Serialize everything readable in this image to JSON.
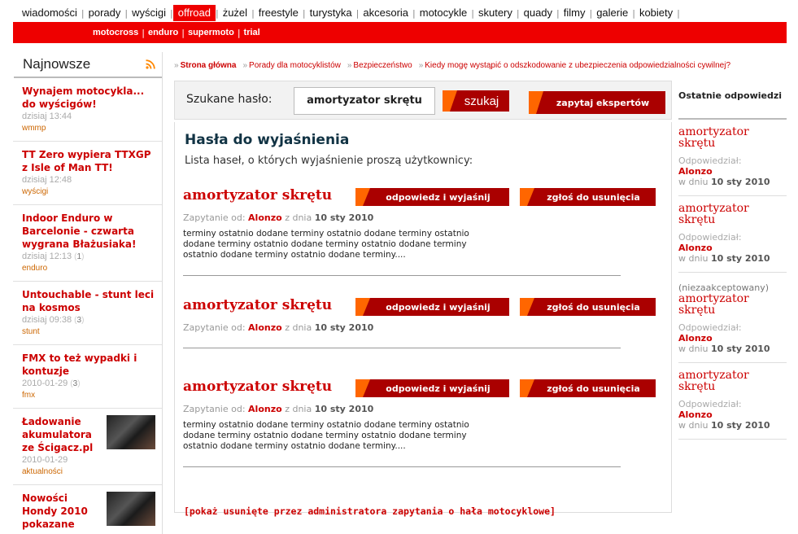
{
  "topnav": {
    "items": [
      "wiadomości",
      "porady",
      "wyścigi",
      "offroad",
      "żużel",
      "freestyle",
      "turystyka",
      "akcesoria",
      "motocykle",
      "skutery",
      "quady",
      "filmy",
      "galerie",
      "kobiety"
    ],
    "separator": "|",
    "active_index": 3
  },
  "subnav": {
    "items": [
      "motocross",
      "enduro",
      "supermoto",
      "trial"
    ],
    "separator": "|"
  },
  "left": {
    "title": "Najnowsze",
    "rss_icon": "rss-icon",
    "news": [
      {
        "title": "Wynajem motocykla... do wyścigów!",
        "time": "dzisiaj 13:44",
        "comments": "",
        "category": "wmmp",
        "thumb": false
      },
      {
        "title": "TT Zero wypiera TTXGP z Isle of Man TT!",
        "time": "dzisiaj 12:48",
        "comments": "",
        "category": "wyścigi",
        "thumb": false
      },
      {
        "title": "Indoor Enduro w Barcelonie - czwarta wygrana Błażusiaka!",
        "time": "dzisiaj 12:13",
        "comments": "1",
        "category": "enduro",
        "thumb": false
      },
      {
        "title": "Untouchable - stunt leci na kosmos",
        "time": "dzisiaj 09:38",
        "comments": "3",
        "category": "stunt",
        "thumb": false
      },
      {
        "title": "FMX to też wypadki i kontuzje",
        "time": "2010-01-29",
        "comments": "3",
        "category": "fmx",
        "thumb": false
      },
      {
        "title": "Ładowanie akumulatora ze Ścigacz.pl",
        "time": "2010-01-29",
        "comments": "",
        "category": "aktualności",
        "thumb": true
      },
      {
        "title": "Nowości Hondy 2010 pokazane",
        "time": "",
        "comments": "",
        "category": "",
        "thumb": true
      }
    ]
  },
  "breadcrumbs": {
    "arrow": "»",
    "items": [
      "Strona główna",
      "Porady dla motocyklistów",
      "Bezpieczeństwo",
      "Kiedy mogę wystąpić o odszkodowanie z ubezpieczenia odpowiedzialności cywilnej?"
    ]
  },
  "search": {
    "label": "Szukane hasło:",
    "value": "amortyzator skrętu",
    "button": "szukaj",
    "ask_button": "zapytaj ekspertów"
  },
  "main": {
    "title": "Hasła do wyjaśnienia",
    "lead": "Lista haseł, o których wyjaśnienie proszą użytkownicy:",
    "answer_button": "odpowiedz i wyjaśnij",
    "delete_button": "zgłoś do usunięcia",
    "asked_by": "Zapytanie od:",
    "date_prefix": "z dnia",
    "entries": [
      {
        "keyword": "amortyzator skrętu",
        "user": "Alonzo",
        "date": "10 sty 2010",
        "text": "terminy ostatnio dodane terminy ostatnio dodane terminy ostatnio dodane terminy ostatnio dodane terminy ostatnio dodane terminy ostatnio dodane terminy ostatnio dodane terminy...."
      },
      {
        "keyword": "amortyzator skrętu",
        "user": "Alonzo",
        "date": "10 sty 2010",
        "text": ""
      },
      {
        "keyword": "amortyzator skrętu",
        "user": "Alonzo",
        "date": "10 sty 2010",
        "text": "terminy ostatnio dodane terminy ostatnio dodane terminy ostatnio dodane terminy ostatnio dodane terminy ostatnio dodane terminy ostatnio dodane terminy ostatnio dodane terminy...."
      }
    ],
    "show_deleted": "[pokaż usunięte przez administratora zapytania o hała motocyklowe]"
  },
  "right": {
    "title": "Ostatnie odpowiedzi",
    "answered_label": "Odpowiedział:",
    "date_prefix": "w dniu",
    "answers": [
      {
        "keyword": "amortyzator skrętu",
        "note": "",
        "user": "Alonzo",
        "date": "10 sty 2010"
      },
      {
        "keyword": "amortyzator skrętu",
        "note": "",
        "user": "Alonzo",
        "date": "10 sty 2010"
      },
      {
        "keyword": "amortyzator skrętu",
        "note": "(niezaakceptowany)",
        "user": "Alonzo",
        "date": "10 sty 2010"
      },
      {
        "keyword": "amortyzator skrętu",
        "note": "",
        "user": "Alonzo",
        "date": "10 sty 2010"
      }
    ]
  }
}
